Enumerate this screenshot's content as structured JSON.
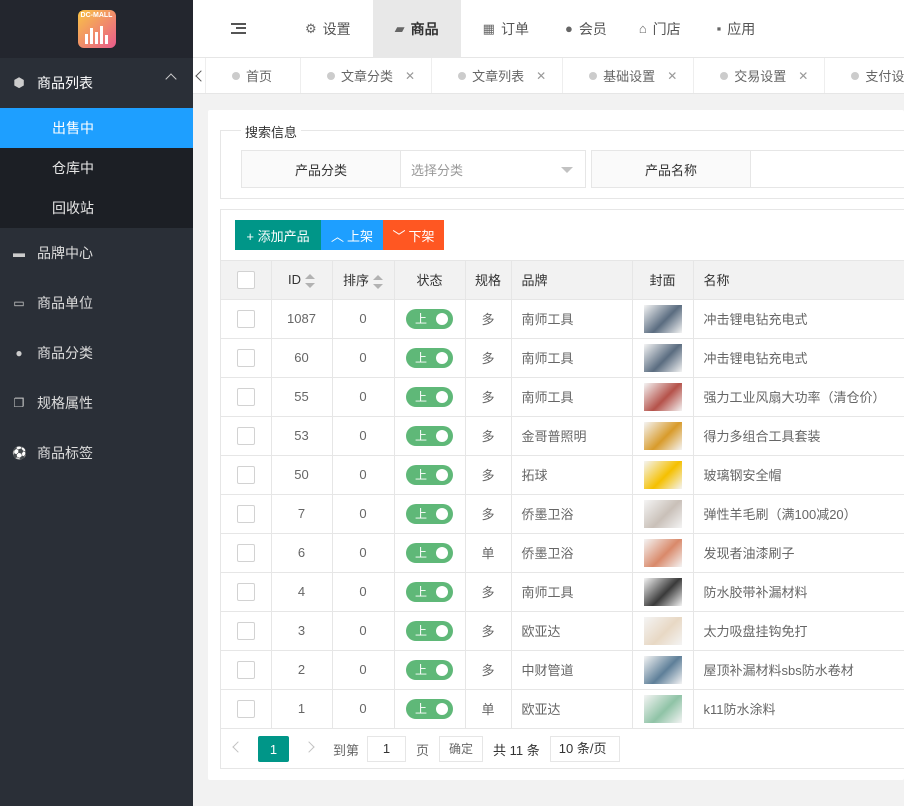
{
  "sidebar": {
    "logo_text": "DC-MALL",
    "group": {
      "label": "商品列表",
      "icon": "cube-icon"
    },
    "sub_items": [
      {
        "label": "出售中",
        "active": true
      },
      {
        "label": "仓库中",
        "active": false
      },
      {
        "label": "回收站",
        "active": false
      }
    ],
    "items": [
      {
        "label": "品牌中心",
        "icon": "briefcase-icon"
      },
      {
        "label": "商品单位",
        "icon": "keyboard-icon"
      },
      {
        "label": "商品分类",
        "icon": "chevron-circle-up-icon"
      },
      {
        "label": "规格属性",
        "icon": "copy-icon"
      },
      {
        "label": "商品标签",
        "icon": "soccer-ball-icon"
      }
    ]
  },
  "topnav": [
    {
      "label": "设置",
      "icon": "cogs-icon",
      "glyph": "⚙",
      "active": false
    },
    {
      "label": "商品",
      "icon": "shopping-bag-icon",
      "glyph": "▰",
      "active": true
    },
    {
      "label": "订单",
      "icon": "table-icon",
      "glyph": "▦",
      "active": false
    },
    {
      "label": "会员",
      "icon": "user-icon",
      "glyph": "●",
      "active": false
    },
    {
      "label": "门店",
      "icon": "institution-icon",
      "glyph": "⌂",
      "active": false
    },
    {
      "label": "应用",
      "icon": "grid-icon",
      "glyph": "▪",
      "active": false
    }
  ],
  "page_tabs": [
    {
      "label": "首页",
      "closable": false
    },
    {
      "label": "文章分类",
      "closable": true
    },
    {
      "label": "文章列表",
      "closable": true
    },
    {
      "label": "基础设置",
      "closable": true
    },
    {
      "label": "交易设置",
      "closable": true
    },
    {
      "label": "支付设",
      "closable": false
    }
  ],
  "search": {
    "legend": "搜索信息",
    "category_label": "产品分类",
    "category_placeholder": "选择分类",
    "name_label": "产品名称"
  },
  "toolbar": {
    "add_label": "+ 添加产品",
    "up_label": "上架",
    "down_label": "下架"
  },
  "table": {
    "headers": {
      "id": "ID",
      "sort": "排序",
      "status": "状态",
      "spec": "规格",
      "brand": "品牌",
      "cover": "封面",
      "name": "名称"
    },
    "rows": [
      {
        "id": "1087",
        "sort": "0",
        "status": "上",
        "spec": "多",
        "brand": "南师工具",
        "name": "冲击锂电钻充电式",
        "thumb_color": "#5a6c80"
      },
      {
        "id": "60",
        "sort": "0",
        "status": "上",
        "spec": "多",
        "brand": "南师工具",
        "name": "冲击锂电钻充电式",
        "thumb_color": "#5a6c80"
      },
      {
        "id": "55",
        "sort": "0",
        "status": "上",
        "spec": "多",
        "brand": "南师工具",
        "name": "强力工业风扇大功率（清仓价）",
        "thumb_color": "#b5524a"
      },
      {
        "id": "53",
        "sort": "0",
        "status": "上",
        "spec": "多",
        "brand": "金哥普照明",
        "name": "得力多组合工具套装",
        "thumb_color": "#d89b2b"
      },
      {
        "id": "50",
        "sort": "0",
        "status": "上",
        "spec": "多",
        "brand": "拓球",
        "name": "玻璃钢安全帽",
        "thumb_color": "#f5c000"
      },
      {
        "id": "7",
        "sort": "0",
        "status": "上",
        "spec": "多",
        "brand": "侨墨卫浴",
        "name": "弹性羊毛刷（满100减20）",
        "thumb_color": "#c9c0b8"
      },
      {
        "id": "6",
        "sort": "0",
        "status": "上",
        "spec": "单",
        "brand": "侨墨卫浴",
        "name": "发现者油漆刷子",
        "thumb_color": "#d9896a"
      },
      {
        "id": "4",
        "sort": "0",
        "status": "上",
        "spec": "多",
        "brand": "南师工具",
        "name": "防水胶带补漏材料",
        "thumb_color": "#3a3a3a"
      },
      {
        "id": "3",
        "sort": "0",
        "status": "上",
        "spec": "多",
        "brand": "欧亚达",
        "name": "太力吸盘挂钩免打",
        "thumb_color": "#e8d8c4"
      },
      {
        "id": "2",
        "sort": "0",
        "status": "上",
        "spec": "多",
        "brand": "中财管道",
        "name": "屋顶补漏材料sbs防水卷材",
        "thumb_color": "#5e7f99"
      },
      {
        "id": "1",
        "sort": "0",
        "status": "上",
        "spec": "单",
        "brand": "欧亚达",
        "name": "k11防水涂料",
        "thumb_color": "#8fc3a6"
      }
    ]
  },
  "pager": {
    "current": "1",
    "goto_label": "到第",
    "goto_value": "1",
    "page_unit": "页",
    "ok_label": "确定",
    "total_label": "共 11 条",
    "page_size": "10 条/页"
  },
  "colors": {
    "sidebar_bg": "#2a2f37",
    "active_blue": "#1e9fff",
    "teal": "#009688",
    "orange": "#ff5722",
    "switch_green": "#5fb878"
  }
}
